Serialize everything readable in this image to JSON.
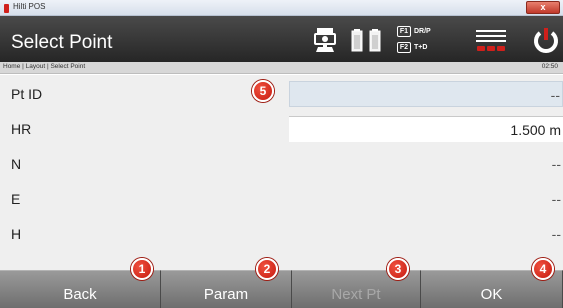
{
  "window": {
    "title": "Hilti POS",
    "close_label": "x"
  },
  "header": {
    "title": "Select Point",
    "icons": [
      "instrument-icon",
      "battery-icon",
      "battery-icon",
      "menu-icon",
      "power-icon"
    ],
    "f1": {
      "key": "F1",
      "label": "DR/P"
    },
    "f2": {
      "key": "F2",
      "label": "T+D"
    }
  },
  "breadcrumb": {
    "text": "Home | Layout | Select Point",
    "time": "02:50"
  },
  "fields": [
    {
      "label": "Pt ID",
      "value": "--"
    },
    {
      "label": "HR",
      "value": "1.500 m"
    },
    {
      "label": "N",
      "value": "--"
    },
    {
      "label": "E",
      "value": "--"
    },
    {
      "label": "H",
      "value": "--"
    }
  ],
  "softkeys": [
    {
      "label": "Back",
      "badge": "1",
      "enabled": true
    },
    {
      "label": "Param",
      "badge": "2",
      "enabled": true
    },
    {
      "label": "Next Pt",
      "badge": "3",
      "enabled": false
    },
    {
      "label": "OK",
      "badge": "4",
      "enabled": true
    }
  ],
  "field_callout": "5",
  "colors": {
    "accent": "#d0201b",
    "header_bg": "#333333",
    "softkey_bg": "#838383"
  }
}
